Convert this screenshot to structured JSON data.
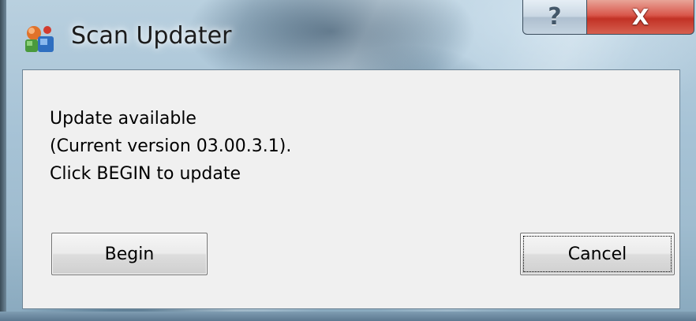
{
  "window": {
    "title": "Scan Updater",
    "app_icon": "scan-updater-app-icon"
  },
  "caption_buttons": {
    "help_label": "?",
    "close_label": "X"
  },
  "message": {
    "line1": "Update available",
    "line2": "(Current version 03.00.3.1).",
    "line3": "Click BEGIN to update"
  },
  "buttons": {
    "begin_label": "Begin",
    "cancel_label": "Cancel"
  },
  "colors": {
    "close_button": "#c23225",
    "client_background": "#f0f0f0"
  }
}
